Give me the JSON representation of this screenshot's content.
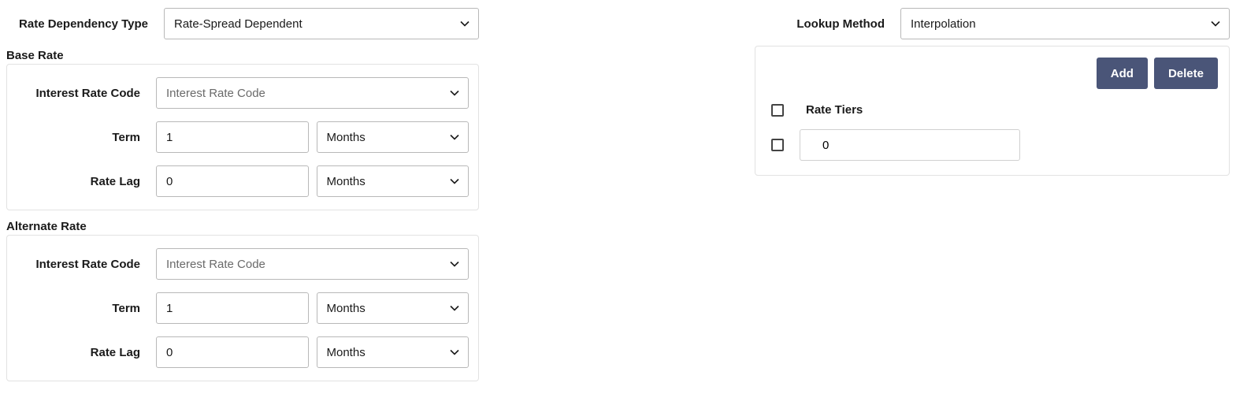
{
  "left": {
    "rateDependencyType": {
      "label": "Rate Dependency Type",
      "value": "Rate-Spread Dependent"
    },
    "baseRate": {
      "title": "Base Rate",
      "interestRateCode": {
        "label": "Interest Rate Code",
        "placeholder": "Interest Rate Code"
      },
      "term": {
        "label": "Term",
        "value": "1",
        "unit": "Months"
      },
      "rateLag": {
        "label": "Rate Lag",
        "value": "0",
        "unit": "Months"
      }
    },
    "alternateRate": {
      "title": "Alternate Rate",
      "interestRateCode": {
        "label": "Interest Rate Code",
        "placeholder": "Interest Rate Code"
      },
      "term": {
        "label": "Term",
        "value": "1",
        "unit": "Months"
      },
      "rateLag": {
        "label": "Rate Lag",
        "value": "0",
        "unit": "Months"
      }
    }
  },
  "right": {
    "lookupMethod": {
      "label": "Lookup Method",
      "value": "Interpolation"
    },
    "tiers": {
      "addLabel": "Add",
      "deleteLabel": "Delete",
      "header": "Rate Tiers",
      "rows": [
        {
          "value": "0"
        }
      ]
    }
  }
}
